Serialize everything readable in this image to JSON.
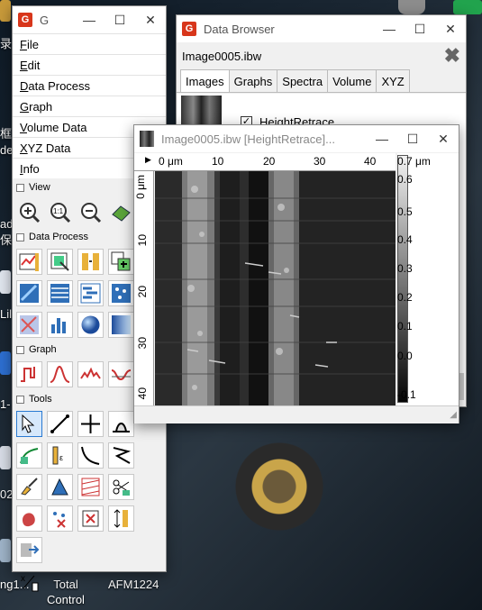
{
  "desktop": {
    "labels": [
      {
        "text": "ng1...",
        "id": "label-ng1"
      },
      {
        "text": "Total\nControl",
        "id": "label-total-control"
      },
      {
        "text": "AFM1224",
        "id": "label-afm1224"
      }
    ],
    "edge_texts": [
      "录",
      "框",
      "de",
      "ada",
      "保和",
      "Lil",
      "1-",
      "02"
    ]
  },
  "menu_window": {
    "title": "G",
    "menu": [
      {
        "label": "File",
        "ul": "F",
        "rest": "ile"
      },
      {
        "label": "Edit",
        "ul": "E",
        "rest": "dit"
      },
      {
        "label": "Data Process",
        "ul": "D",
        "rest": "ata Process"
      },
      {
        "label": "Graph",
        "ul": "G",
        "rest": "raph"
      },
      {
        "label": "Volume Data",
        "ul": "V",
        "rest": "olume Data"
      },
      {
        "label": "XYZ Data",
        "ul": "X",
        "rest": "YZ Data"
      },
      {
        "label": "Info",
        "ul": "I",
        "rest": "nfo"
      }
    ],
    "sections": {
      "view": "View",
      "data_process": "Data Process",
      "graph": "Graph",
      "tools": "Tools"
    }
  },
  "data_browser": {
    "title": "Data Browser",
    "file_name": "Image0005.ibw",
    "tabs": [
      "Images",
      "Graphs",
      "Spectra",
      "Volume",
      "XYZ"
    ],
    "active_tab": "Images",
    "channel": "HeightRetrace",
    "channel_checked": true
  },
  "image_window": {
    "title": "Image0005.ibw [HeightRetrace]...",
    "x_ticks": [
      "0 μm",
      "10",
      "20",
      "30",
      "40"
    ],
    "y_ticks": [
      "0 μm",
      "10",
      "20",
      "30",
      "40"
    ],
    "colorbar_ticks": [
      "0.7 μm",
      "0.6",
      "0.5",
      "0.4",
      "0.3",
      "0.2",
      "0.1",
      "0.0",
      "-0.1"
    ]
  },
  "colors": {
    "accent": "#d8361b",
    "select": "#2a7ad2"
  }
}
